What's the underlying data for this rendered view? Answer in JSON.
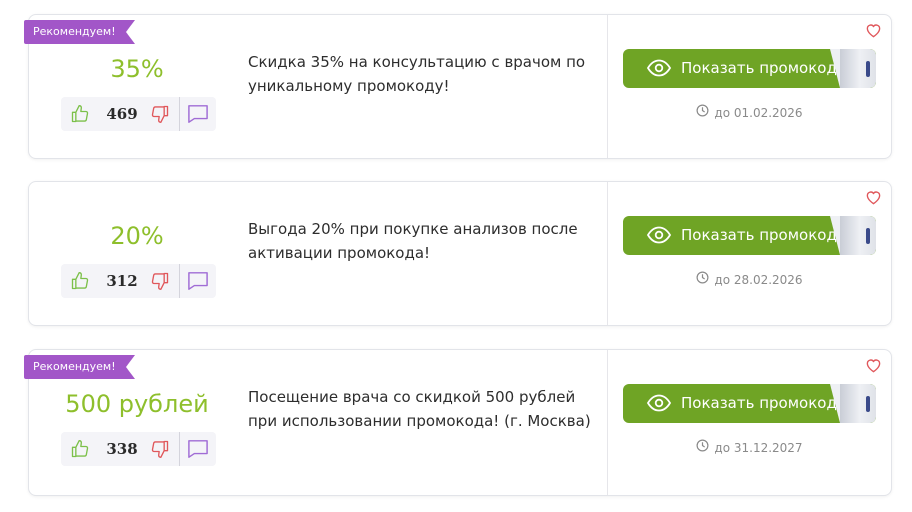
{
  "colors": {
    "accent_green": "#8ebf2c",
    "button_green": "#6fa425",
    "badge_purple": "#a256c8",
    "thumb_up": "#7cc04a",
    "thumb_down": "#e0575b",
    "comment": "#a06cd5"
  },
  "icons": {
    "eye": "eye-icon",
    "clock": "clock-icon",
    "heart": "heart-icon",
    "like": "thumbs-up-icon",
    "dislike": "thumbs-down-icon",
    "comment": "comment-icon"
  },
  "offers": [
    {
      "badge": "Рекомендуем!",
      "discount": "35%",
      "votes": "469",
      "description": "Скидка 35% на консультацию с врачом по уникальному промокоду!",
      "button_label": "Показать промокод",
      "expiry": "до 01.02.2026"
    },
    {
      "badge": "",
      "discount": "20%",
      "votes": "312",
      "description": "Выгода 20% при покупке анализов после активации промокода!",
      "button_label": "Показать промокод",
      "expiry": "до 28.02.2026"
    },
    {
      "badge": "Рекомендуем!",
      "discount": "500 рублей",
      "votes": "338",
      "description": "Посещение врача со скидкой 500 рублей при использовании промокода! (г. Москва)",
      "button_label": "Показать промокод",
      "expiry": "до 31.12.2027"
    }
  ]
}
